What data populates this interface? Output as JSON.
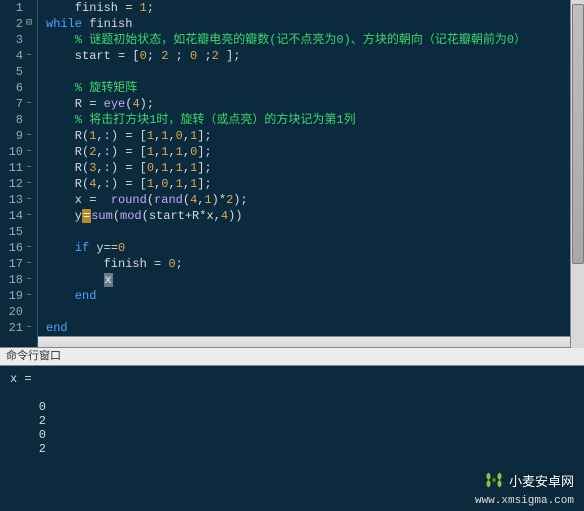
{
  "editor": {
    "lines": [
      {
        "n": 1,
        "fold": "",
        "tokens": [
          {
            "c": "id",
            "t": "    finish "
          },
          {
            "c": "op",
            "t": "= "
          },
          {
            "c": "num",
            "t": "1"
          },
          {
            "c": "op",
            "t": ";"
          }
        ]
      },
      {
        "n": 2,
        "fold": "⊟",
        "tokens": [
          {
            "c": "kw",
            "t": "while"
          },
          {
            "c": "id",
            "t": " finish"
          }
        ]
      },
      {
        "n": 3,
        "fold": "",
        "tokens": [
          {
            "c": "cm",
            "t": "    % 谜题初始状态，如花瓣电亮的瓣数(记不点亮为0)、方块的朝向（记花瓣朝前为0）"
          }
        ]
      },
      {
        "n": 4,
        "fold": "-",
        "tokens": [
          {
            "c": "id",
            "t": "    start "
          },
          {
            "c": "op",
            "t": "= ["
          },
          {
            "c": "num",
            "t": "0"
          },
          {
            "c": "op",
            "t": "; "
          },
          {
            "c": "num",
            "t": "2"
          },
          {
            "c": "op",
            "t": " ; "
          },
          {
            "c": "num",
            "t": "0"
          },
          {
            "c": "op",
            "t": " ;"
          },
          {
            "c": "num",
            "t": "2"
          },
          {
            "c": "op",
            "t": " ];"
          }
        ]
      },
      {
        "n": 5,
        "fold": "",
        "tokens": [
          {
            "c": "id",
            "t": " "
          }
        ]
      },
      {
        "n": 6,
        "fold": "",
        "tokens": [
          {
            "c": "cm",
            "t": "    % 旋转矩阵"
          }
        ]
      },
      {
        "n": 7,
        "fold": "-",
        "tokens": [
          {
            "c": "id",
            "t": "    R "
          },
          {
            "c": "op",
            "t": "= "
          },
          {
            "c": "fn",
            "t": "eye"
          },
          {
            "c": "op",
            "t": "("
          },
          {
            "c": "num",
            "t": "4"
          },
          {
            "c": "op",
            "t": ");"
          }
        ]
      },
      {
        "n": 8,
        "fold": "",
        "tokens": [
          {
            "c": "cm",
            "t": "    % 将击打方块1时，旋转（或点亮）的方块记为第1列"
          }
        ]
      },
      {
        "n": 9,
        "fold": "-",
        "tokens": [
          {
            "c": "id",
            "t": "    R("
          },
          {
            "c": "num",
            "t": "1"
          },
          {
            "c": "op",
            "t": ",:) = ["
          },
          {
            "c": "num",
            "t": "1"
          },
          {
            "c": "op",
            "t": ","
          },
          {
            "c": "num",
            "t": "1"
          },
          {
            "c": "op",
            "t": ","
          },
          {
            "c": "num",
            "t": "0"
          },
          {
            "c": "op",
            "t": ","
          },
          {
            "c": "num",
            "t": "1"
          },
          {
            "c": "op",
            "t": "];"
          }
        ]
      },
      {
        "n": 10,
        "fold": "-",
        "tokens": [
          {
            "c": "id",
            "t": "    R("
          },
          {
            "c": "num",
            "t": "2"
          },
          {
            "c": "op",
            "t": ",:) = ["
          },
          {
            "c": "num",
            "t": "1"
          },
          {
            "c": "op",
            "t": ","
          },
          {
            "c": "num",
            "t": "1"
          },
          {
            "c": "op",
            "t": ","
          },
          {
            "c": "num",
            "t": "1"
          },
          {
            "c": "op",
            "t": ","
          },
          {
            "c": "num",
            "t": "0"
          },
          {
            "c": "op",
            "t": "];"
          }
        ]
      },
      {
        "n": 11,
        "fold": "-",
        "tokens": [
          {
            "c": "id",
            "t": "    R("
          },
          {
            "c": "num",
            "t": "3"
          },
          {
            "c": "op",
            "t": ",:) = ["
          },
          {
            "c": "num",
            "t": "0"
          },
          {
            "c": "op",
            "t": ","
          },
          {
            "c": "num",
            "t": "1"
          },
          {
            "c": "op",
            "t": ","
          },
          {
            "c": "num",
            "t": "1"
          },
          {
            "c": "op",
            "t": ","
          },
          {
            "c": "num",
            "t": "1"
          },
          {
            "c": "op",
            "t": "];"
          }
        ]
      },
      {
        "n": 12,
        "fold": "-",
        "tokens": [
          {
            "c": "id",
            "t": "    R("
          },
          {
            "c": "num",
            "t": "4"
          },
          {
            "c": "op",
            "t": ",:) = ["
          },
          {
            "c": "num",
            "t": "1"
          },
          {
            "c": "op",
            "t": ","
          },
          {
            "c": "num",
            "t": "0"
          },
          {
            "c": "op",
            "t": ","
          },
          {
            "c": "num",
            "t": "1"
          },
          {
            "c": "op",
            "t": ","
          },
          {
            "c": "num",
            "t": "1"
          },
          {
            "c": "op",
            "t": "];"
          }
        ]
      },
      {
        "n": 13,
        "fold": "-",
        "tokens": [
          {
            "c": "id",
            "t": "    x "
          },
          {
            "c": "op",
            "t": "=  "
          },
          {
            "c": "fn",
            "t": "round"
          },
          {
            "c": "op",
            "t": "("
          },
          {
            "c": "fn",
            "t": "rand"
          },
          {
            "c": "op",
            "t": "("
          },
          {
            "c": "num",
            "t": "4"
          },
          {
            "c": "op",
            "t": ","
          },
          {
            "c": "num",
            "t": "1"
          },
          {
            "c": "op",
            "t": ")*"
          },
          {
            "c": "num",
            "t": "2"
          },
          {
            "c": "op",
            "t": ");"
          }
        ]
      },
      {
        "n": 14,
        "fold": "-",
        "tokens": [
          {
            "c": "id",
            "t": "    y"
          },
          {
            "c": "ylw",
            "t": "="
          },
          {
            "c": "fn",
            "t": "sum"
          },
          {
            "c": "op",
            "t": "("
          },
          {
            "c": "fn",
            "t": "mod"
          },
          {
            "c": "op",
            "t": "(start+R*x,"
          },
          {
            "c": "num",
            "t": "4"
          },
          {
            "c": "op",
            "t": "))"
          }
        ]
      },
      {
        "n": 15,
        "fold": "",
        "tokens": [
          {
            "c": "id",
            "t": " "
          }
        ]
      },
      {
        "n": 16,
        "fold": "-",
        "tokens": [
          {
            "c": "id",
            "t": "    "
          },
          {
            "c": "kw",
            "t": "if"
          },
          {
            "c": "id",
            "t": " y"
          },
          {
            "c": "op",
            "t": "=="
          },
          {
            "c": "num",
            "t": "0"
          }
        ]
      },
      {
        "n": 17,
        "fold": "-",
        "tokens": [
          {
            "c": "id",
            "t": "        finish "
          },
          {
            "c": "op",
            "t": "= "
          },
          {
            "c": "num",
            "t": "0"
          },
          {
            "c": "op",
            "t": ";"
          }
        ]
      },
      {
        "n": 18,
        "fold": "-",
        "tokens": [
          {
            "c": "id",
            "t": "        "
          },
          {
            "c": "hl",
            "t": "x"
          }
        ]
      },
      {
        "n": 19,
        "fold": "-",
        "tokens": [
          {
            "c": "id",
            "t": "    "
          },
          {
            "c": "kw",
            "t": "end"
          }
        ]
      },
      {
        "n": 20,
        "fold": "",
        "tokens": [
          {
            "c": "id",
            "t": " "
          }
        ]
      },
      {
        "n": 21,
        "fold": "-",
        "tokens": [
          {
            "c": "kw",
            "t": "end"
          }
        ]
      }
    ]
  },
  "console": {
    "title": "命令行窗口",
    "output": "x =\n\n    0\n    2\n    0\n    2"
  },
  "watermarks": {
    "brand1": "小麦安卓网",
    "brand2": "www.xmsigma.com"
  }
}
